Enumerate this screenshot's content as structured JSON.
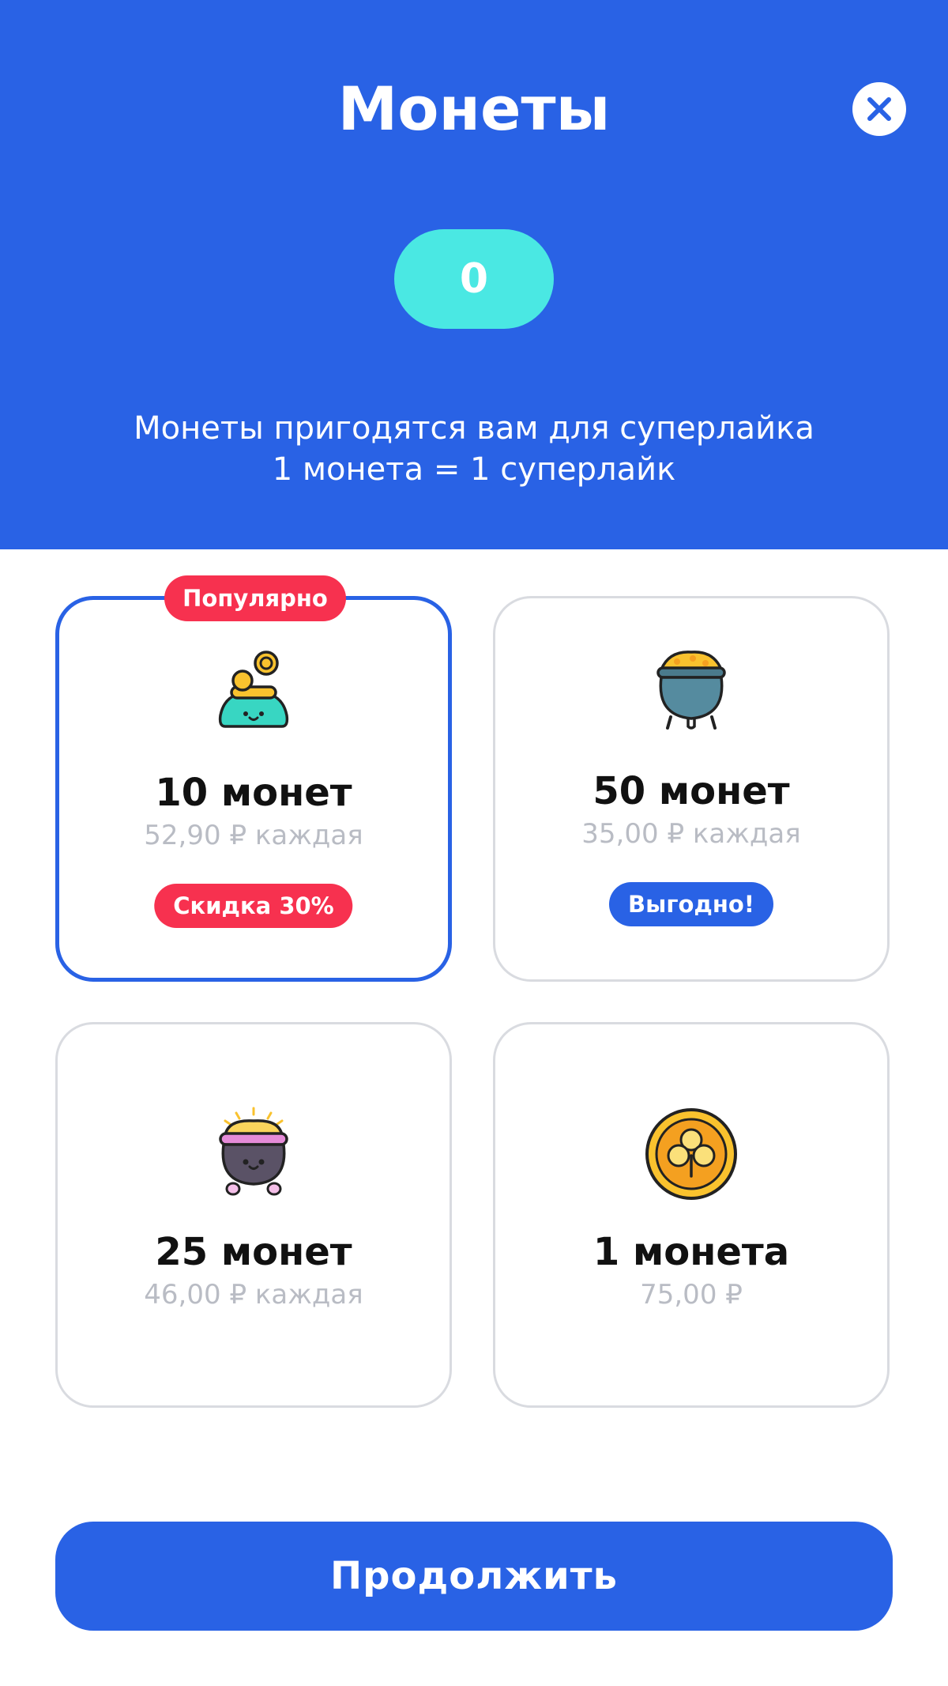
{
  "header": {
    "title": "Монеты",
    "balance": "0",
    "subtitle_line1": "Монеты пригодятся вам для суперлайка",
    "subtitle_line2": "1 монета = 1 суперлайк"
  },
  "packages": [
    {
      "name": "10 монет",
      "price": "52,90 ₽ каждая",
      "badge_top": "Популярно",
      "tag": "Скидка 30%",
      "icon": "coin-bag-icon",
      "selected": true
    },
    {
      "name": "50 монет",
      "price": "35,00 ₽ каждая",
      "tag": "Выгодно!",
      "icon": "pot-of-gold-icon",
      "selected": false
    },
    {
      "name": "25 монет",
      "price": "46,00 ₽ каждая",
      "icon": "cauldron-icon",
      "selected": false
    },
    {
      "name": "1 монета",
      "price": "75,00 ₽",
      "icon": "clover-coin-icon",
      "selected": false
    }
  ],
  "actions": {
    "continue_label": "Продолжить"
  },
  "colors": {
    "primary": "#2962E5",
    "balance_pill": "#4AE8E3",
    "accent_red": "#F7314F",
    "muted_text": "#B9BCC4"
  }
}
